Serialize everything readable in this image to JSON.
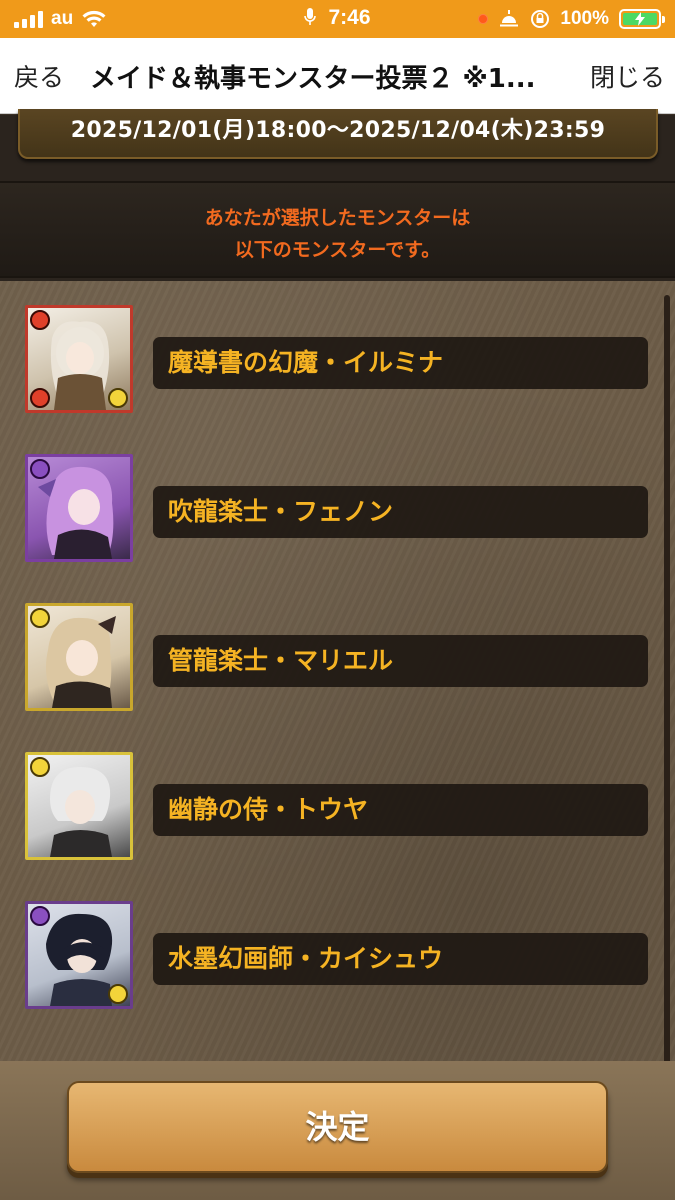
{
  "status_bar": {
    "carrier": "au",
    "time": "7:46",
    "battery_percent": "100%",
    "icons": [
      "signal-icon",
      "wifi-icon",
      "mic-icon",
      "orange-dot-icon",
      "alarm-icon",
      "orientation-lock-icon",
      "battery-charging-icon"
    ]
  },
  "nav": {
    "back_label": "戻る",
    "title": "メイド＆執事モンスター投票２ ※1...",
    "close_label": "閉じる"
  },
  "period": "2025/12/01(月)18:00〜2025/12/04(木)23:59",
  "notice_lines": [
    "あなたが選択したモンスターは",
    "以下のモンスターです。"
  ],
  "monsters": [
    {
      "name": "魔導書の幻魔・イルミナ",
      "main_attr": "fire",
      "sub_attr": "light",
      "frame_color": "#c0392b",
      "bg": "#e8e1d5"
    },
    {
      "name": "吹龍楽士・フェノン",
      "main_attr": "dark",
      "sub_attr": "",
      "frame_color": "#7b3fa0",
      "bg": "#a06ac4"
    },
    {
      "name": "管龍楽士・マリエル",
      "main_attr": "light",
      "sub_attr": "",
      "frame_color": "#c9a72c",
      "bg": "#e9ddc9"
    },
    {
      "name": "幽静の侍・トウヤ",
      "main_attr": "light",
      "sub_attr": "",
      "frame_color": "#d9c23a",
      "bg": "#d9d9d9"
    },
    {
      "name": "水墨幻画師・カイシュウ",
      "main_attr": "dark",
      "sub_attr": "light",
      "frame_color": "#6a3d8c",
      "bg": "#cfd3dc"
    }
  ],
  "decide_label": "決定",
  "colors": {
    "status_bar": "#f09a1a",
    "notice_text": "#f26a1f",
    "name_text": "#f5b323",
    "fire": "#e0402a",
    "dark": "#8a4fc0",
    "light": "#f2d43a"
  }
}
